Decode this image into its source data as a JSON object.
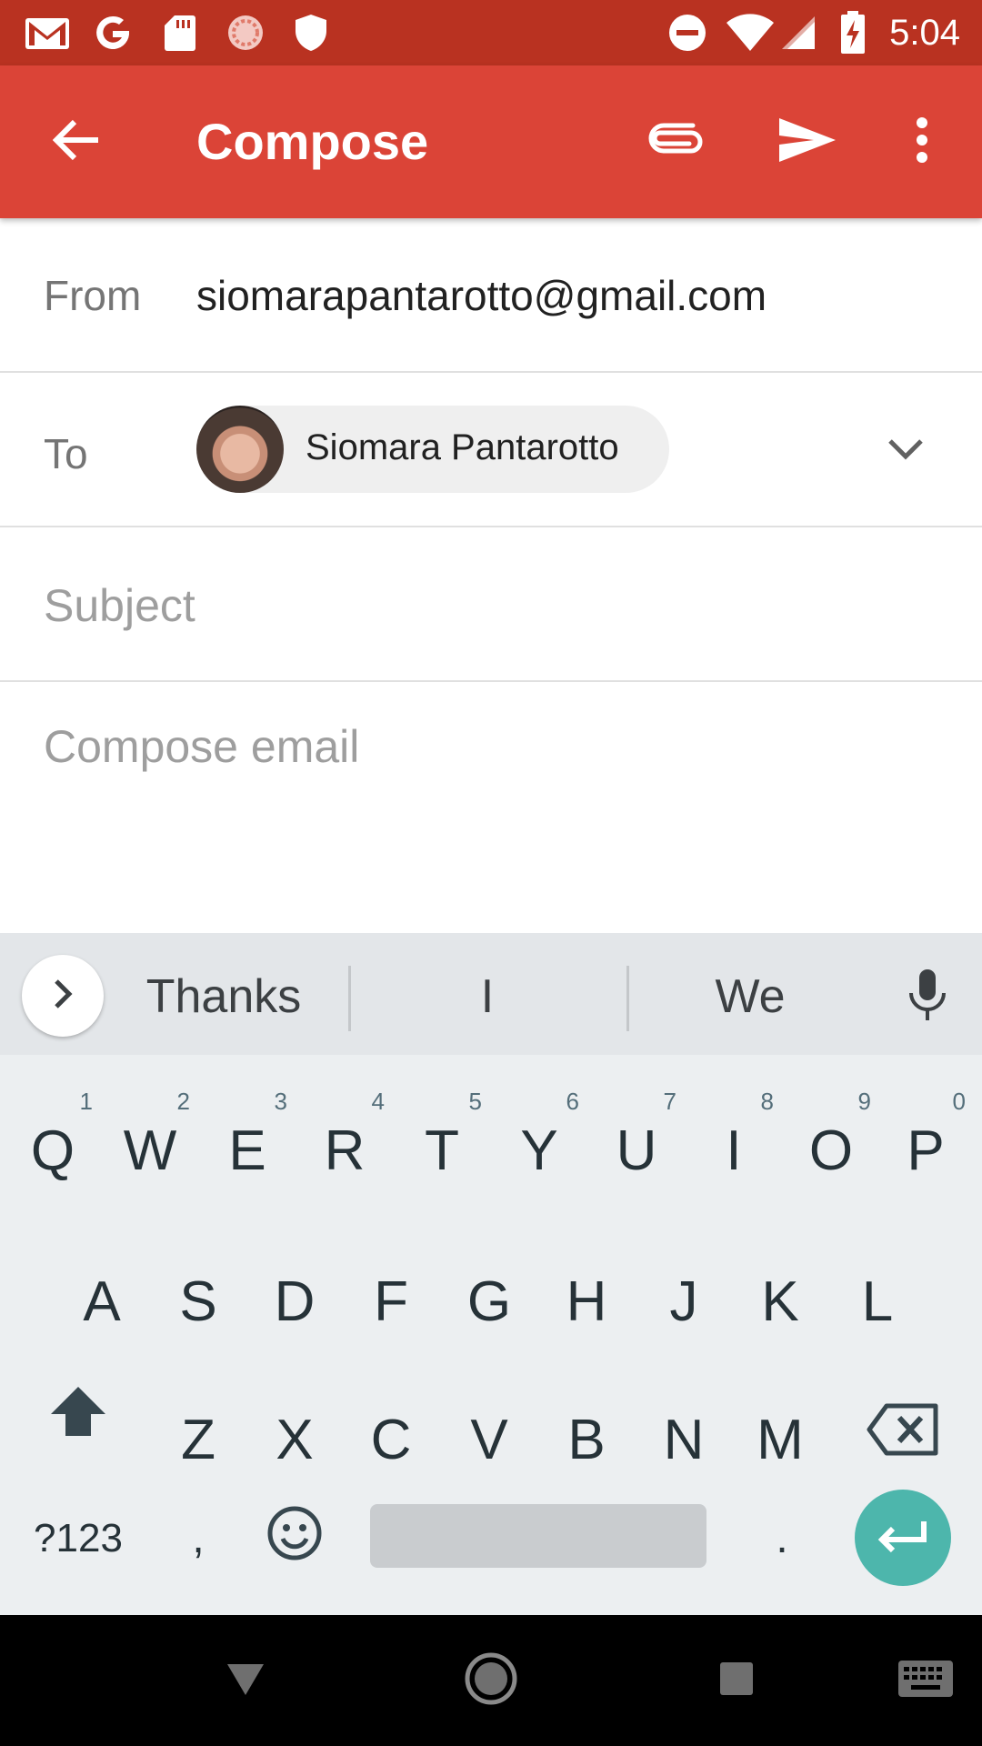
{
  "status_bar": {
    "time": "5:04",
    "icons": [
      "gmail-icon",
      "google-icon",
      "sd-card-icon",
      "sync-icon",
      "shield-icon",
      "do-not-disturb-icon",
      "wifi-icon",
      "signal-icon",
      "battery-charging-icon"
    ]
  },
  "app_bar": {
    "title": "Compose",
    "back_icon": "arrow-back-icon",
    "attach_icon": "paperclip-icon",
    "send_icon": "send-icon",
    "more_icon": "more-vert-icon",
    "color": "#db4437"
  },
  "compose": {
    "from_label": "From",
    "from_value": "siomarapantarotto@gmail.com",
    "to_label": "To",
    "to_recipient": "Siomara Pantarotto",
    "subject_placeholder": "Subject",
    "body_placeholder": "Compose email"
  },
  "keyboard": {
    "suggestions": [
      "Thanks",
      "I",
      "We"
    ],
    "row1": [
      {
        "key": "Q",
        "hint": "1"
      },
      {
        "key": "W",
        "hint": "2"
      },
      {
        "key": "E",
        "hint": "3"
      },
      {
        "key": "R",
        "hint": "4"
      },
      {
        "key": "T",
        "hint": "5"
      },
      {
        "key": "Y",
        "hint": "6"
      },
      {
        "key": "U",
        "hint": "7"
      },
      {
        "key": "I",
        "hint": "8"
      },
      {
        "key": "O",
        "hint": "9"
      },
      {
        "key": "P",
        "hint": "0"
      }
    ],
    "row2": [
      "A",
      "S",
      "D",
      "F",
      "G",
      "H",
      "J",
      "K",
      "L"
    ],
    "row3": [
      "Z",
      "X",
      "C",
      "V",
      "B",
      "N",
      "M"
    ],
    "symbols_label": "?123",
    "comma": ",",
    "period": ".",
    "accent": "#4db6ac"
  },
  "nav_bar": {
    "icons": [
      "back-triangle-icon",
      "home-circle-icon",
      "recents-square-icon",
      "keyboard-switch-icon"
    ]
  }
}
